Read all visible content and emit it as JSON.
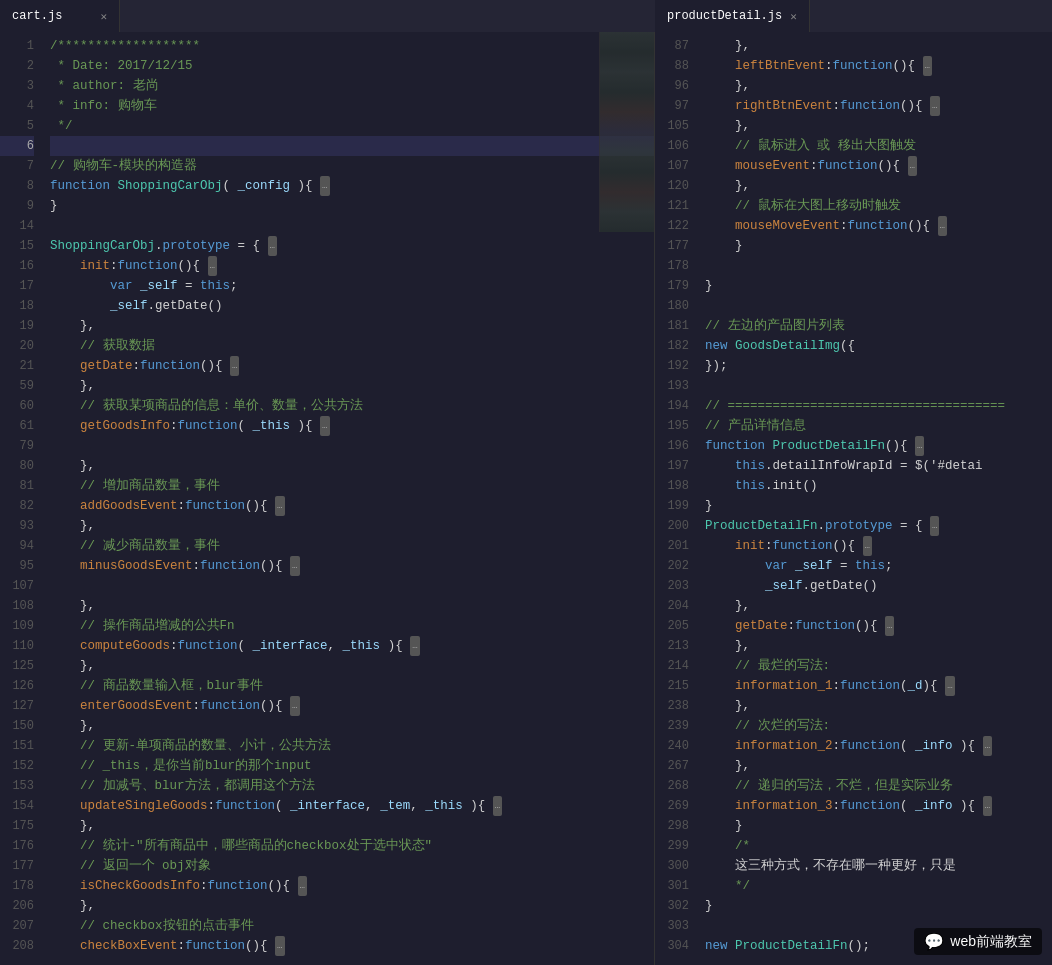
{
  "tabs": {
    "left": {
      "filename": "cart.js",
      "active": true
    },
    "right": {
      "filename": "productDetail.js",
      "active": true
    }
  },
  "left_code": [
    {
      "ln": 1,
      "code": "/*******************"
    },
    {
      "ln": 2,
      "code": " * Date: 2017/12/15"
    },
    {
      "ln": 3,
      "code": " * author: 老尚"
    },
    {
      "ln": 4,
      "code": " * info: 购物车"
    },
    {
      "ln": 5,
      "code": " */"
    },
    {
      "ln": 6,
      "code": "",
      "active": true
    },
    {
      "ln": 7,
      "code": "// 购物车-模块的构造器"
    },
    {
      "ln": 8,
      "code": "function ShoppingCarObj( _config ){"
    },
    {
      "ln": 9,
      "code": "}"
    },
    {
      "ln": 14,
      "code": ""
    },
    {
      "ln": 15,
      "code": "ShoppingCarObj.prototype = {"
    },
    {
      "ln": 16,
      "code": "    init:function(){"
    },
    {
      "ln": 17,
      "code": "        var _self = this;"
    },
    {
      "ln": 18,
      "code": "        _self.getDate()"
    },
    {
      "ln": 19,
      "code": "    },"
    },
    {
      "ln": 20,
      "code": "    // 获取数据"
    },
    {
      "ln": 21,
      "code": "    getDate:function(){"
    },
    {
      "ln": 59,
      "code": "    },"
    },
    {
      "ln": 60,
      "code": "    // 获取某项商品的信息：单价、数量，公共方法"
    },
    {
      "ln": 61,
      "code": "    getGoodsInfo:function( _this ){"
    },
    {
      "ln": 79,
      "code": ""
    },
    {
      "ln": 80,
      "code": "    },"
    },
    {
      "ln": 81,
      "code": "    // 增加商品数量，事件"
    },
    {
      "ln": 82,
      "code": "    addGoodsEvent:function(){"
    },
    {
      "ln": 93,
      "code": "    },"
    },
    {
      "ln": 94,
      "code": "    // 减少商品数量，事件"
    },
    {
      "ln": 95,
      "code": "    minusGoodsEvent:function(){"
    },
    {
      "ln": 107,
      "code": ""
    },
    {
      "ln": 108,
      "code": "    },"
    },
    {
      "ln": 109,
      "code": "    // 操作商品增减的公共Fn"
    },
    {
      "ln": 110,
      "code": "    computeGoods:function( _interface, _this ){"
    },
    {
      "ln": 125,
      "code": "    },"
    },
    {
      "ln": 126,
      "code": "    // 商品数量输入框，blur事件"
    },
    {
      "ln": 127,
      "code": "    enterGoodsEvent:function(){"
    },
    {
      "ln": 150,
      "code": "    },"
    },
    {
      "ln": 151,
      "code": "    // 更新-单项商品的数量、小计，公共方法"
    },
    {
      "ln": 152,
      "code": "    // _this，是你当前blur的那个input"
    },
    {
      "ln": 153,
      "code": "    // 加减号、blur方法，都调用这个方法"
    },
    {
      "ln": 154,
      "code": "    updateSingleGoods:function( _interface, _tem, _this ){"
    },
    {
      "ln": 175,
      "code": "    },"
    },
    {
      "ln": 176,
      "code": "    // 统计-\"所有商品中，哪些商品的checkbox处于选中状态\""
    },
    {
      "ln": 177,
      "code": "    // 返回一个 obj对象"
    },
    {
      "ln": 178,
      "code": "    isCheckGoodsInfo:function(){"
    },
    {
      "ln": 206,
      "code": "    },"
    },
    {
      "ln": 207,
      "code": "    // checkbox按钮的点击事件"
    },
    {
      "ln": 208,
      "code": "    checkBoxEvent:function(){"
    }
  ],
  "right_code": [
    {
      "ln": 87,
      "code": "    },"
    },
    {
      "ln": 88,
      "code": "    leftBtnEvent:function(){"
    },
    {
      "ln": 96,
      "code": "    },"
    },
    {
      "ln": 97,
      "code": "    rightBtnEvent:function(){"
    },
    {
      "ln": 105,
      "code": "    },"
    },
    {
      "ln": 106,
      "code": "    // 鼠标进入 或 移出大图触发"
    },
    {
      "ln": 107,
      "code": "    mouseEvent:function(){"
    },
    {
      "ln": 120,
      "code": "    },"
    },
    {
      "ln": 121,
      "code": "    // 鼠标在大图上移动时触发"
    },
    {
      "ln": 122,
      "code": "    mouseMoveEvent:function(){"
    },
    {
      "ln": 177,
      "code": "    }"
    },
    {
      "ln": 178,
      "code": ""
    },
    {
      "ln": 179,
      "code": "}"
    },
    {
      "ln": 180,
      "code": ""
    },
    {
      "ln": 181,
      "code": "// 左边的产品图片列表"
    },
    {
      "ln": 182,
      "code": "new GoodsDetailImg({"
    },
    {
      "ln": 192,
      "code": "});"
    },
    {
      "ln": 193,
      "code": ""
    },
    {
      "ln": 194,
      "code": "// ====================================="
    },
    {
      "ln": 195,
      "code": "// 产品详情信息"
    },
    {
      "ln": 196,
      "code": "function ProductDetailFn(){"
    },
    {
      "ln": 197,
      "code": "    this.detailInfoWrapId = $('#detai"
    },
    {
      "ln": 198,
      "code": "    this.init()"
    },
    {
      "ln": 199,
      "code": "}"
    },
    {
      "ln": 200,
      "code": "ProductDetailFn.prototype = {"
    },
    {
      "ln": 201,
      "code": "    init:function(){"
    },
    {
      "ln": 202,
      "code": "        var _self = this;"
    },
    {
      "ln": 203,
      "code": "        _self.getDate()"
    },
    {
      "ln": 204,
      "code": "    },"
    },
    {
      "ln": 205,
      "code": "    getDate:function(){"
    },
    {
      "ln": 213,
      "code": "    },"
    },
    {
      "ln": 214,
      "code": "    // 最烂的写法:"
    },
    {
      "ln": 215,
      "code": "    information_1:function(_d){"
    },
    {
      "ln": 238,
      "code": "    },"
    },
    {
      "ln": 239,
      "code": "    // 次烂的写法:"
    },
    {
      "ln": 240,
      "code": "    information_2:function( _info ){"
    },
    {
      "ln": 267,
      "code": "    },"
    },
    {
      "ln": 268,
      "code": "    // 递归的写法，不烂，但是实际业务"
    },
    {
      "ln": 269,
      "code": "    information_3:function( _info ){"
    },
    {
      "ln": 298,
      "code": "    }"
    },
    {
      "ln": 299,
      "code": "    /*"
    },
    {
      "ln": 300,
      "code": "    这三种方式，不存在哪一种更好，只是"
    },
    {
      "ln": 301,
      "code": "    */"
    },
    {
      "ln": 302,
      "code": "}"
    },
    {
      "ln": 303,
      "code": ""
    },
    {
      "ln": 304,
      "code": "new ProductDetailFn();"
    }
  ],
  "watermark": {
    "icon": "💬",
    "text": "web前端教室"
  }
}
